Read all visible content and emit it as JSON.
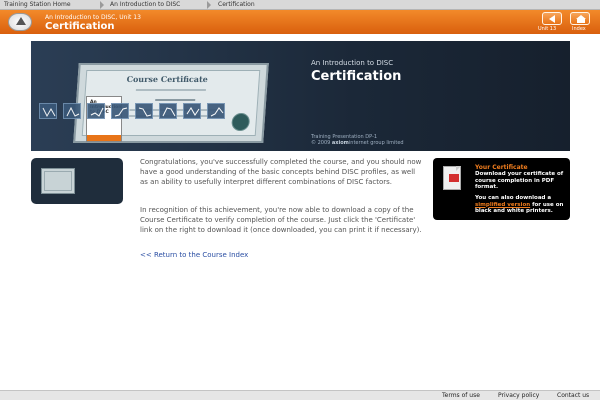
{
  "breadcrumb": [
    "Training Station Home",
    "An Introduction to DISC",
    "Certification"
  ],
  "header": {
    "subtitle": "An Introduction to DISC, Unit 13",
    "title": "Certification",
    "back_label": "Unit 13",
    "index_label": "Index"
  },
  "banner": {
    "subtitle": "An Introduction to DISC",
    "title": "Certification",
    "certificate_title": "Course Certificate",
    "book_line1": "An Introduction",
    "book_line2": "to DISC",
    "footer_line1": "Training Presentation DP-1",
    "footer_copyright_prefix": "© 2009",
    "footer_company_bold": "axiom",
    "footer_company_rest": "internet group limited"
  },
  "content": {
    "paragraph1": "Congratulations, you've successfully completed the course, and you should now have a good understanding of the basic concepts behind DISC profiles, as well as an ability to usefully interpret different combinations of DISC factors.",
    "paragraph2": "In recognition of this achievement, you're now able to download a copy of the Course Certificate to verify completion of the course. Just click the 'Certificate' link on the right to download it (once downloaded, you can print it if necessary).",
    "back_link": "<< Return to the Course Index"
  },
  "certificate_card": {
    "title": "Your Certificate",
    "text1": "Download your certificate of course completion in PDF format.",
    "text2_prefix": "You can also download a",
    "link": "simplified version",
    "text2_suffix": "for use on black and white printers."
  },
  "footer": {
    "terms": "Terms of use",
    "privacy": "Privacy policy",
    "contact": "Contact us"
  },
  "colors": {
    "accent_orange": "#e8741a",
    "banner_dark": "#1d2b3d",
    "link_blue": "#2a4ea3"
  }
}
